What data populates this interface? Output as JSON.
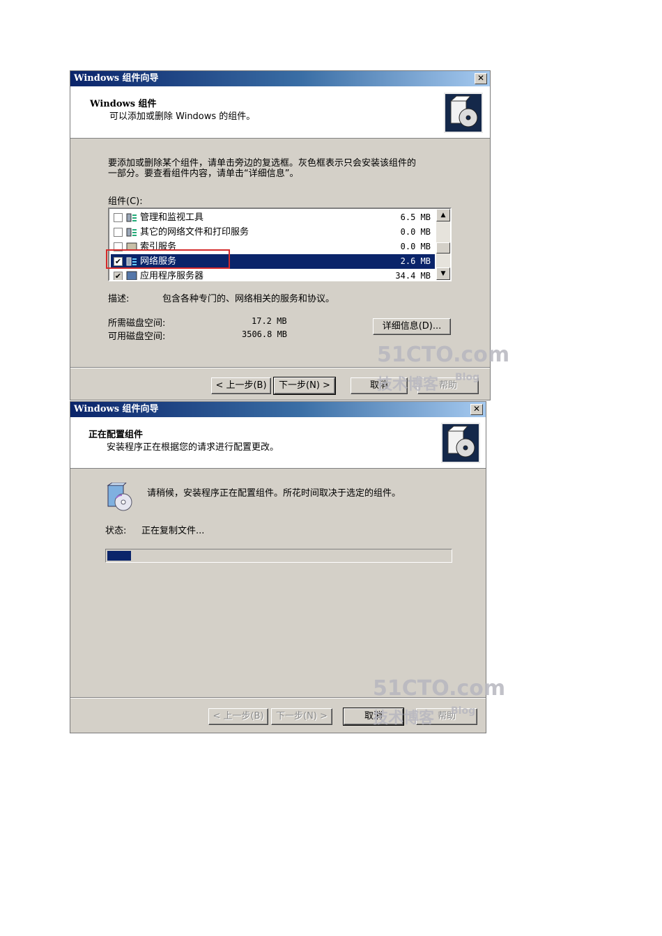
{
  "dialog1": {
    "title": "Windows 组件向导",
    "close_glyph": "✕",
    "header_title": "Windows 组件",
    "header_subtitle": "可以添加或删除 Windows 的组件。",
    "instruction_line1": "要添加或删除某个组件，请单击旁边的复选框。灰色框表示只会安装该组件的",
    "instruction_line2": "一部分。要查看组件内容，请单击“详细信息”。",
    "components_label": "组件(C):",
    "components": [
      {
        "label": "管理和监视工具",
        "size": "6.5 MB",
        "checked": false
      },
      {
        "label": "其它的网络文件和打印服务",
        "size": "0.0 MB",
        "checked": false
      },
      {
        "label": "索引服务",
        "size": "0.0 MB",
        "checked": false
      },
      {
        "label": "网络服务",
        "size": "2.6 MB",
        "checked": true,
        "selected": true
      },
      {
        "label": "应用程序服务器",
        "size": "34.4 MB",
        "checked": true
      }
    ],
    "check_glyph": "✔",
    "description_label": "描述:",
    "description_text": "包含各种专门的、网络相关的服务和协议。",
    "disk_required_label": "所需磁盘空间:",
    "disk_required_value": "17.2 MB",
    "disk_available_label": "可用磁盘空间:",
    "disk_available_value": "3506.8 MB",
    "details_button": "详细信息(D)...",
    "back_button": "< 上一步(B)",
    "next_button": "下一步(N) >",
    "cancel_button": "取消",
    "help_button": "帮助",
    "watermark_main": "51CTO.com",
    "watermark_sub": "技术博客",
    "watermark_blog": "Blog"
  },
  "dialog2": {
    "title": "Windows 组件向导",
    "close_glyph": "✕",
    "header_title": "正在配置组件",
    "header_subtitle": "安装程序正在根据您的请求进行配置更改。",
    "wait_message": "请稍候，安装程序正在配置组件。所花时间取决于选定的组件。",
    "status_label": "状态:",
    "status_value": "正在复制文件...",
    "progress_fraction": 0.07,
    "back_button": "< 上一步(B)",
    "next_button": "下一步(N) >",
    "cancel_button": "取消",
    "help_button": "帮助",
    "watermark_main": "51CTO.com",
    "watermark_sub": "技术博客",
    "watermark_blog": "Blog"
  },
  "icons": {
    "wizard": "box-cd-icon",
    "component": "network-component-icon",
    "setup": "setup-cd-icon"
  }
}
